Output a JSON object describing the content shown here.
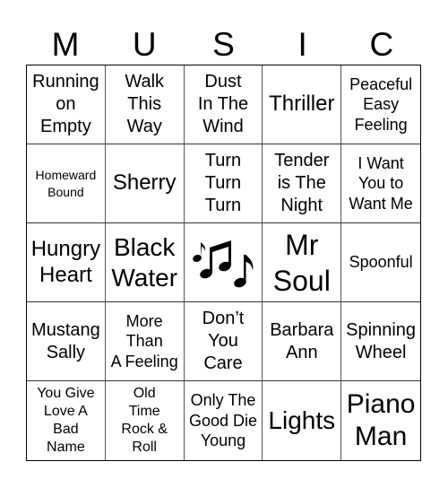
{
  "card": {
    "header": [
      "M",
      "U",
      "S",
      "I",
      "C"
    ],
    "free_space": {
      "icon": "music-notes-icon"
    },
    "rows": [
      [
        {
          "text": "Running\non\nEmpty",
          "size": "s20"
        },
        {
          "text": "Walk\nThis\nWay",
          "size": "s20"
        },
        {
          "text": "Dust\nIn The\nWind",
          "size": "s20"
        },
        {
          "text": "Thriller",
          "size": "s24"
        },
        {
          "text": "Peaceful\nEasy\nFeeling",
          "size": "s18"
        }
      ],
      [
        {
          "text": "Homeward\nBound",
          "size": "s14"
        },
        {
          "text": "Sherry",
          "size": "s24"
        },
        {
          "text": "Turn\nTurn\nTurn",
          "size": "s20"
        },
        {
          "text": "Tender\nis The\nNight",
          "size": "s20"
        },
        {
          "text": "I Want\nYou to\nWant Me",
          "size": "s18"
        }
      ],
      [
        {
          "text": "Hungry\nHeart",
          "size": "s24"
        },
        {
          "text": "Black\nWater",
          "size": "s28"
        },
        {
          "free": true
        },
        {
          "text": "Mr\nSoul",
          "size": "s32"
        },
        {
          "text": "Spoonful",
          "size": "s18"
        }
      ],
      [
        {
          "text": "Mustang\nSally",
          "size": "s20"
        },
        {
          "text": "More\nThan\nA Feeling",
          "size": "s18"
        },
        {
          "text": "Don’t\nYou\nCare",
          "size": "s20"
        },
        {
          "text": "Barbara\nAnn",
          "size": "s20"
        },
        {
          "text": "Spinning\nWheel",
          "size": "s20"
        }
      ],
      [
        {
          "text": "You Give\nLove A\nBad\nName",
          "size": "s16"
        },
        {
          "text": "Old\nTime\nRock &\nRoll",
          "size": "s16"
        },
        {
          "text": "Only The\nGood Die\nYoung",
          "size": "s18"
        },
        {
          "text": "Lights",
          "size": "s28"
        },
        {
          "text": "Piano\nMan",
          "size": "s30"
        }
      ]
    ]
  }
}
